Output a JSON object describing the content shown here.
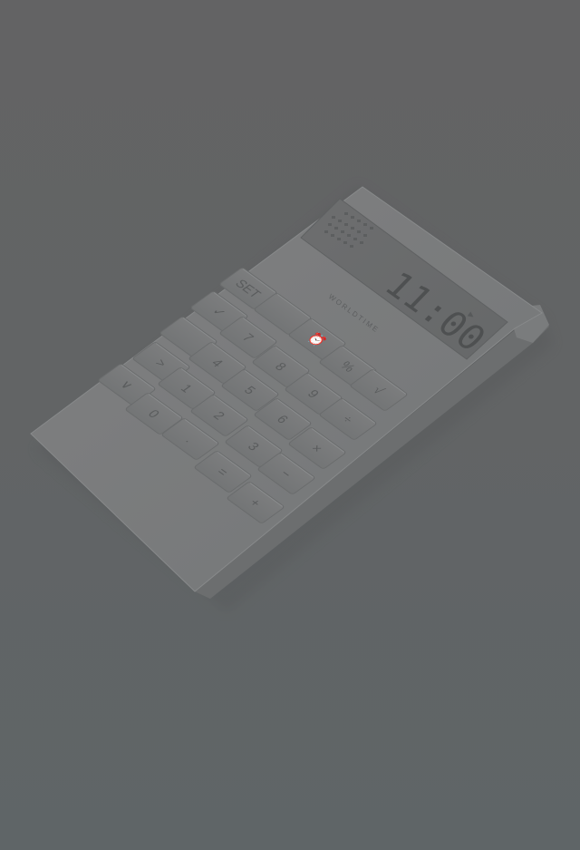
{
  "device": {
    "brand": "WORLDTIME",
    "display": {
      "time": "11:00",
      "indicator": "▶"
    }
  },
  "keys": [
    {
      "id": "key-sum",
      "label": "",
      "sub": ""
    },
    {
      "id": "key-set",
      "label": "SET",
      "sub": ""
    },
    {
      "id": "key-check",
      "label": "✓",
      "sub": ""
    },
    {
      "id": "key-store",
      "label": "",
      "sub": ""
    },
    {
      "id": "key-mode",
      "label": "",
      "sub": ""
    },
    {
      "id": "key-seven",
      "label": "7",
      "sub": ""
    },
    {
      "id": "key-alarm",
      "label": "⏰",
      "sub": ""
    },
    {
      "id": "key-right",
      "label": ">",
      "sub": ""
    },
    {
      "id": "key-four",
      "label": "4",
      "sub": ""
    },
    {
      "id": "key-eight",
      "label": "8",
      "sub": ""
    },
    {
      "id": "key-percent",
      "label": "%",
      "sub": ""
    },
    {
      "id": "key-down",
      "label": "∨",
      "sub": ""
    },
    {
      "id": "key-one",
      "label": "1",
      "sub": ""
    },
    {
      "id": "key-five",
      "label": "5",
      "sub": ""
    },
    {
      "id": "key-nine",
      "label": "9",
      "sub": ""
    },
    {
      "id": "key-sqrt",
      "label": "√",
      "sub": ""
    },
    {
      "id": "key-zero",
      "label": "0",
      "sub": ""
    },
    {
      "id": "key-two",
      "label": "2",
      "sub": ""
    },
    {
      "id": "key-six",
      "label": "6",
      "sub": ""
    },
    {
      "id": "key-divide",
      "label": "÷",
      "sub": ""
    },
    {
      "id": "key-dot",
      "label": ".",
      "sub": ""
    },
    {
      "id": "key-three",
      "label": "3",
      "sub": ""
    },
    {
      "id": "key-multiply",
      "label": "×",
      "sub": ""
    },
    {
      "id": "key-equals",
      "label": "=",
      "sub": ""
    },
    {
      "id": "key-minus",
      "label": "−",
      "sub": ""
    },
    {
      "id": "key-plus",
      "label": "+",
      "sub": ""
    }
  ]
}
